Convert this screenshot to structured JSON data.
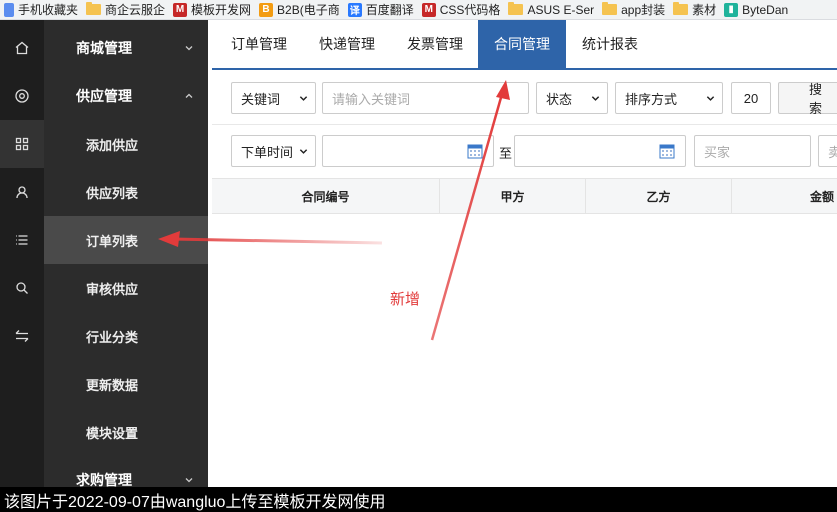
{
  "bookmarks": [
    {
      "label": "手机收藏夹",
      "icon": "page-icon",
      "color": "#5b8def"
    },
    {
      "label": "商企云服企",
      "icon": "folder-icon"
    },
    {
      "label": "模板开发网",
      "icon": "m-logo-icon",
      "color": "#c62828",
      "glyph": "M"
    },
    {
      "label": "B2B(电子商",
      "icon": "b2b-logo-icon",
      "color": "#f39c12",
      "glyph": "B"
    },
    {
      "label": "百度翻译",
      "icon": "translate-icon",
      "color": "#2979ff",
      "glyph": "译"
    },
    {
      "label": "CSS代码格",
      "icon": "m-logo-icon",
      "color": "#c62828",
      "glyph": "M"
    },
    {
      "label": "ASUS E-Ser",
      "icon": "folder-icon"
    },
    {
      "label": "app封装",
      "icon": "folder-icon"
    },
    {
      "label": "素材",
      "icon": "folder-icon"
    },
    {
      "label": "ByteDan",
      "icon": "bytedance-logo-icon",
      "color": "#1fb39b",
      "glyph": "▮"
    }
  ],
  "rail_icons": [
    "home-icon",
    "target-icon",
    "grid-icon",
    "user-icon",
    "list-icon",
    "search-icon",
    "swap-icon"
  ],
  "sidebar": {
    "groups": [
      {
        "label": "商城管理",
        "expanded": false
      },
      {
        "label": "供应管理",
        "expanded": true
      },
      {
        "label": "求购管理",
        "expanded": false
      }
    ],
    "sub_items": [
      "添加供应",
      "供应列表",
      "订单列表",
      "审核供应",
      "行业分类",
      "更新数据",
      "模块设置"
    ],
    "active_sub": "订单列表"
  },
  "tabs": [
    "订单管理",
    "快递管理",
    "发票管理",
    "合同管理",
    "统计报表"
  ],
  "active_tab": "合同管理",
  "filters": {
    "keyword_select": "关键词",
    "keyword_placeholder": "请输入关键词",
    "status_select": "状态",
    "sort_select": "排序方式",
    "page_size": "20",
    "search_button": "搜 索",
    "date_select": "下单时间",
    "date_separator": "至",
    "buyer_placeholder": "买家",
    "seller_placeholder": "卖"
  },
  "table": {
    "columns": [
      "合同编号",
      "甲方",
      "乙方",
      "金额"
    ]
  },
  "annotation": "新增",
  "watermark": "该图片于2022-09-07由wangluo上传至模板开发网使用",
  "colors": {
    "accent": "#2e64a9",
    "annotation": "#e23b3b"
  }
}
